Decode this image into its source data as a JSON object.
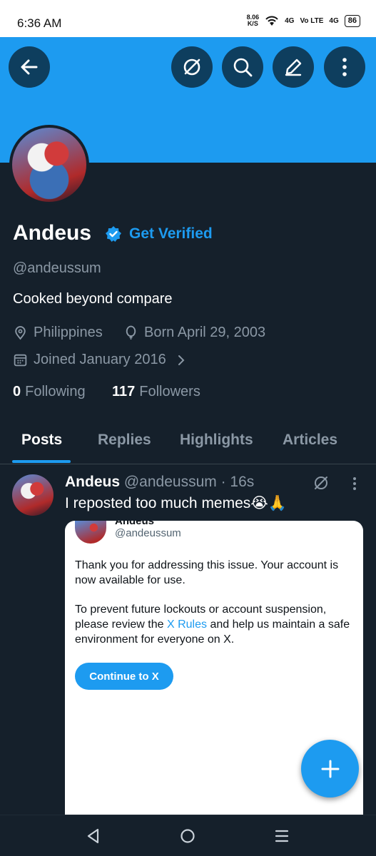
{
  "status_bar": {
    "time": "6:36 AM",
    "net_speed_value": "8.06",
    "net_speed_unit": "K/S",
    "signal_1": "4G",
    "volte": "Vo LTE",
    "signal_2": "4G",
    "battery": "86"
  },
  "header": {
    "icons": [
      "back-arrow-icon",
      "grok-icon",
      "search-icon",
      "edit-icon",
      "more-vertical-icon"
    ],
    "banner_color": "#1d9bf0"
  },
  "profile": {
    "name": "Andeus",
    "get_verified": "Get Verified",
    "handle": "@andeussum",
    "bio": "Cooked beyond compare",
    "location": "Philippines",
    "birthday": "Born April 29, 2003",
    "joined": "Joined January 2016",
    "following_count": "0",
    "following_label": "Following",
    "followers_count": "117",
    "followers_label": "Followers"
  },
  "tabs": [
    {
      "label": "Posts",
      "active": true
    },
    {
      "label": "Replies",
      "active": false
    },
    {
      "label": "Highlights",
      "active": false
    },
    {
      "label": "Articles",
      "active": false
    }
  ],
  "post": {
    "author": "Andeus",
    "meta": "@andeussum · 16s",
    "text": "I reposted too much memes😭🙏",
    "card": {
      "name": "Andeus",
      "handle": "@andeussum",
      "para1": "Thank you for addressing this issue. Your account is now available for use.",
      "para2_before": "To prevent future lockouts or account suspension, please review the ",
      "para2_link": "X Rules",
      "para2_after": " and help us maintain a safe environment for everyone on X.",
      "button": "Continue to X"
    }
  },
  "colors": {
    "accent": "#1d9bf0",
    "background": "#15202b",
    "secondary_text": "#8b98a5"
  }
}
